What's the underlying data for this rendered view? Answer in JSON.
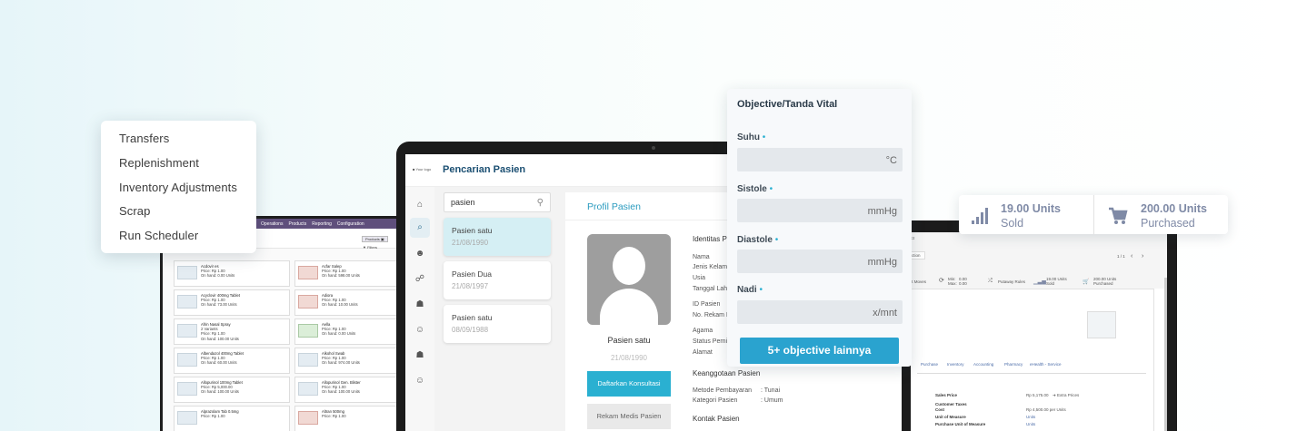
{
  "left_app": {
    "topbar": [
      "Operations",
      "Products",
      "Reporting",
      "Configuration"
    ],
    "toolbar": {
      "filter_chip": "Products ▣",
      "filters": "▼ Filters"
    },
    "products": [
      {
        "name": "Acdovir es",
        "price": "Price: Rp 1.00",
        "onhand": "On hand: 0.00 Units",
        "thumb": "grey"
      },
      {
        "name": "Acfar Salep",
        "price": "Price: Rp 1.00",
        "onhand": "On hand: 598.00 Units",
        "thumb": "red"
      },
      {
        "name": "Acyclovir 400mg Tablet",
        "price": "Price: Rp 1.00",
        "onhand": "On hand: 73.00 Units",
        "thumb": "grey"
      },
      {
        "name": "Adiora",
        "price": "Price: Rp 1.00",
        "onhand": "On hand: 10.00 Units",
        "thumb": "red"
      },
      {
        "name": "Afrin Nasal Spray",
        "price": "2 Variants",
        "onhand": "Price: Rp 1.00",
        "extra": "On hand: 100.00 Units",
        "thumb": "grey"
      },
      {
        "name": "Aella",
        "price": "Price: Rp 1.00",
        "onhand": "On hand: 0.00 Units",
        "thumb": "green"
      },
      {
        "name": "Albendazol 400mg Tablet",
        "price": "Price: Rp 1.00",
        "onhand": "On hand: 60.00 Units",
        "thumb": "grey"
      },
      {
        "name": "Alkohol Swab",
        "price": "Price: Rp 1.00",
        "onhand": "On hand: 974.00 Units",
        "thumb": "grey"
      },
      {
        "name": "Allopurinol 100mg Tablet",
        "price": "Price: Rp 5,000.00",
        "onhand": "On hand: 100.00 Units",
        "thumb": "grey"
      },
      {
        "name": "Allopurinol Gen. Blister",
        "price": "Price: Rp 1.00",
        "onhand": "On hand: 100.00 Units",
        "thumb": "grey"
      },
      {
        "name": "Alprazolam Tab 0.5mg",
        "price": "Price: Rp 1.00",
        "onhand": "",
        "thumb": "grey"
      },
      {
        "name": "Altran 500mg",
        "price": "Price: Rp 1.00",
        "onhand": "",
        "thumb": "red"
      }
    ]
  },
  "menu": {
    "items": [
      "Transfers",
      "Replenishment",
      "Inventory Adjustments",
      "Scrap",
      "Run Scheduler"
    ]
  },
  "center_app": {
    "logo": "■ Your logo",
    "title": "Pencarian Pasien",
    "search_value": "pasien",
    "patients": [
      {
        "name": "Pasien satu",
        "date": "21/08/1990",
        "selected": true
      },
      {
        "name": "Pasien Dua",
        "date": "21/08/1997",
        "selected": false
      },
      {
        "name": "Pasien satu",
        "date": "08/09/1988",
        "selected": false
      }
    ],
    "profile": {
      "title": "Profil Pasien",
      "name": "Pasien satu",
      "date": "21/08/1990",
      "btn_daftar": "Daftarkan Konsultasi",
      "btn_rekam": "Rekam Medis Pasien",
      "identitas_heading": "Identitas Pas",
      "fields": [
        "Nama",
        "Jenis Kelamin",
        "Usia",
        "Tanggal Lahir"
      ],
      "fields2": [
        "ID Pasien",
        "No. Rekam Me"
      ],
      "fields3": [
        "Agama",
        "Status Pernika",
        "Alamat"
      ],
      "keanggotaan_heading": "Keanggotaan Pasien",
      "metode_label": "Metode Pembayaran",
      "metode_value": ": Tunai",
      "kategori_label": "Kategori Pasien",
      "kategori_value": ": Umum",
      "kontak_heading": "Kontak Pasien"
    }
  },
  "vital": {
    "title": "Objective/Tanda Vital",
    "fields": [
      {
        "label": "Suhu",
        "unit": "°C"
      },
      {
        "label": "Sistole",
        "unit": "mmHg"
      },
      {
        "label": "Diastole",
        "unit": "mmHg"
      },
      {
        "label": "Nadi",
        "unit": "x/mnt"
      }
    ],
    "required_mark": "•",
    "more_button": "5+ objective lainnya"
  },
  "stats": {
    "sold_value": "19.00 Units",
    "sold_label": "Sold",
    "purchased_value": "200.00 Units",
    "purchased_label": "Purchased",
    "accent": "#7f8aa6"
  },
  "right_app": {
    "breadcrumb_tail": "uct",
    "edit_btn": "Action",
    "pager": "1 / 1",
    "smart": {
      "moves": "ct Moves",
      "min": "Min:",
      "min_val": "0.00",
      "max": "Max:",
      "max_val": "0.00",
      "putaway": "Putaway Rules",
      "sold_val": "19.00 Units",
      "sold_lbl": "Sold",
      "purch_val": "200.00 Units",
      "purch_lbl": "Purchased"
    },
    "tabs": [
      "Purchase",
      "Inventory",
      "Accounting",
      "Pharmacy",
      "eHealth - Service"
    ],
    "rows": [
      {
        "label": "Sales Price",
        "value": "Rp 5,175.00",
        "extra": "➜ Extra Prices"
      },
      {
        "label": "Customer Taxes",
        "value": ""
      },
      {
        "label": "Cost",
        "value": "Rp 4,500.00 per Units"
      },
      {
        "label": "Unit of Measure",
        "value": "Units"
      },
      {
        "label": "Purchase Unit of Measure",
        "value": "Units"
      }
    ]
  },
  "colors": {
    "primary": "#2ab0d1",
    "header_blue": "#1b4f72",
    "odoo_purple": "#5f4f7c"
  }
}
